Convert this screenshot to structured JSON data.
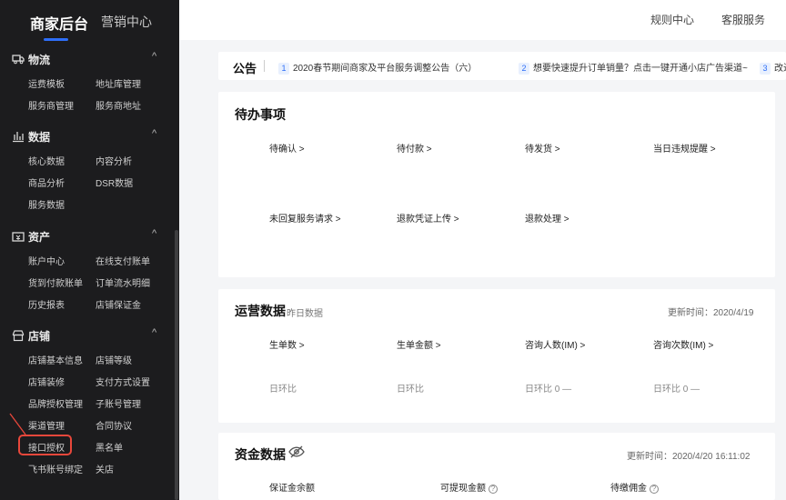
{
  "sidebar": {
    "title_active": "商家后台",
    "title_other": "营销中心",
    "sections": [
      {
        "label": "物流",
        "items": [
          "运费模板",
          "地址库管理",
          "服务商管理",
          "服务商地址"
        ]
      },
      {
        "label": "数据",
        "items": [
          "核心数据",
          "内容分析",
          "商品分析",
          "DSR数据",
          "服务数据"
        ]
      },
      {
        "label": "资产",
        "items": [
          "账户中心",
          "在线支付账单",
          "货到付款账单",
          "订单流水明细",
          "历史报表",
          "店铺保证金"
        ]
      },
      {
        "label": "店铺",
        "items": [
          "店铺基本信息",
          "店铺等级",
          "店铺装修",
          "支付方式设置",
          "品牌授权管理",
          "子账号管理",
          "渠道管理",
          "合同协议",
          "接口授权",
          "黑名单",
          "飞书账号绑定",
          "关店"
        ]
      }
    ],
    "chevron": "^"
  },
  "topbar": {
    "links": [
      "规则中心",
      "客服服务"
    ]
  },
  "notice": {
    "title": "公告",
    "items": [
      {
        "num": "1",
        "text": "2020春节期间商家及平台服务调整公告（六）"
      },
      {
        "num": "2",
        "text": "想要快速提升订单销量？点击一键开通小店广告渠道~"
      },
      {
        "num": "3",
        "text": "改进"
      }
    ]
  },
  "todo": {
    "title": "待办事项",
    "links": [
      "待确认 >",
      "待付款 >",
      "待发货 >",
      "当日违规提醒 >",
      "未回复服务请求 >",
      "退款凭证上传 >",
      "退款处理 >"
    ]
  },
  "ops": {
    "title": "运营数据",
    "subtitle": "昨日数据",
    "updated": "更新时间：2020/4/19",
    "metrics": [
      "生单数 >",
      "生单金额 >",
      "咨询人数(IM) >",
      "咨询次数(IM) >"
    ],
    "compare": [
      "日环比",
      "日环比",
      "日环比 0 —",
      "日环比 0 —"
    ]
  },
  "funds": {
    "title": "资金数据",
    "updated": "更新时间：2020/4/20 16:11:02",
    "metrics": [
      "保证金余额",
      "可提现金额",
      "待缴佣金"
    ]
  },
  "icons": {
    "eye": "eye-off-icon"
  },
  "colors": {
    "accent": "#2e6ef7",
    "highlight": "#e8473b",
    "sidebar_bg": "#1c1c1e"
  }
}
